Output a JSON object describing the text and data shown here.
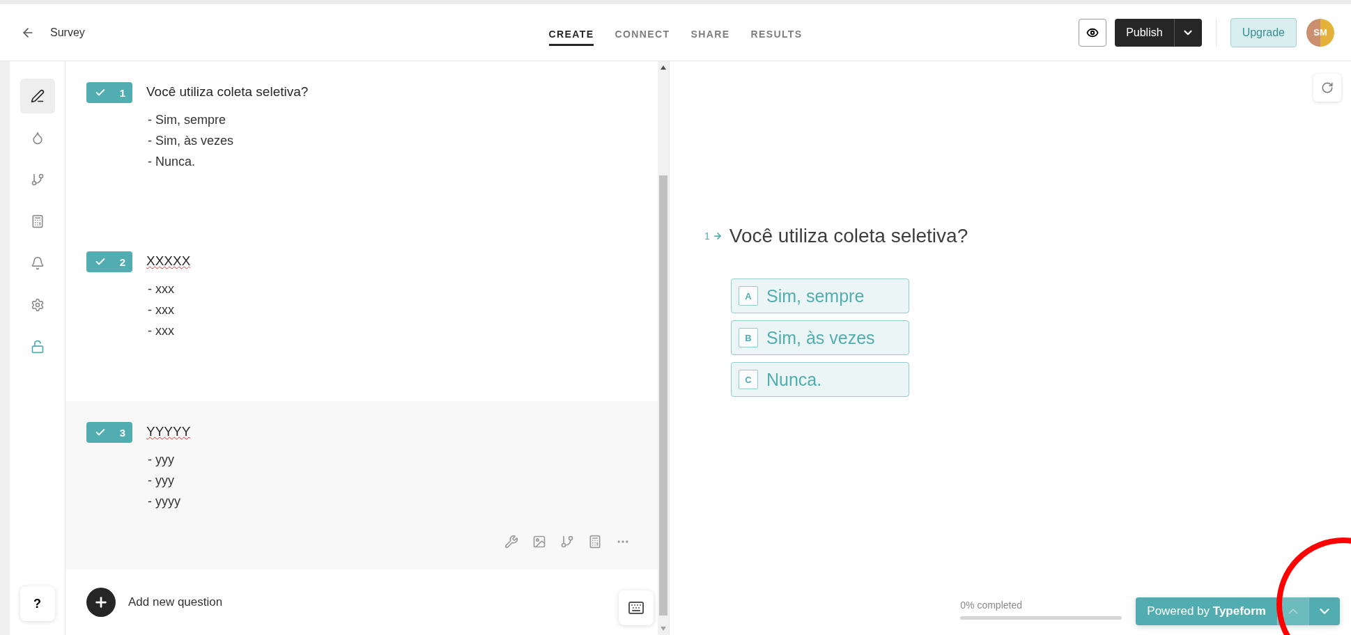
{
  "header": {
    "title": "Survey",
    "tabs": [
      {
        "label": "CREATE",
        "selected": true
      },
      {
        "label": "CONNECT",
        "selected": false
      },
      {
        "label": "SHARE",
        "selected": false
      },
      {
        "label": "RESULTS",
        "selected": false
      }
    ],
    "publish_label": "Publish",
    "upgrade_label": "Upgrade",
    "avatar_initials": "SM"
  },
  "sidebar": {
    "items": [
      {
        "kind": "content",
        "selected": true
      },
      {
        "kind": "design",
        "selected": false
      },
      {
        "kind": "logic",
        "selected": false
      },
      {
        "kind": "calculator",
        "selected": false
      },
      {
        "kind": "notifications",
        "selected": false
      },
      {
        "kind": "settings",
        "selected": false
      },
      {
        "kind": "access",
        "selected": false
      }
    ],
    "help_label": "?"
  },
  "questions": [
    {
      "number": "1",
      "title": "Você utiliza coleta seletiva?",
      "spelling_error": false,
      "selected": false,
      "choices": [
        "- Sim, sempre",
        "- Sim, às vezes",
        "- Nunca."
      ]
    },
    {
      "number": "2",
      "title": "XXXXX",
      "spelling_error": true,
      "selected": false,
      "choices": [
        "- xxx",
        "- xxx",
        "- xxx"
      ]
    },
    {
      "number": "3",
      "title": "YYYYY",
      "spelling_error": true,
      "selected": true,
      "choices": [
        "- yyy",
        "- yyy",
        "- yyyy"
      ]
    }
  ],
  "add_question_label": "Add new question",
  "preview": {
    "number": "1",
    "title": "Você utiliza coleta seletiva?",
    "choices": [
      {
        "key": "A",
        "label": "Sim, sempre"
      },
      {
        "key": "B",
        "label": "Sim, às vezes"
      },
      {
        "key": "C",
        "label": "Nunca."
      }
    ],
    "progress_label": "0% completed",
    "progress": {
      "level": 0
    },
    "powered_by": "Powered by **Typeform**",
    "nav_buttons": [
      {
        "kind": "previous",
        "disabled": true
      },
      {
        "kind": "next",
        "disabled": false
      }
    ]
  }
}
